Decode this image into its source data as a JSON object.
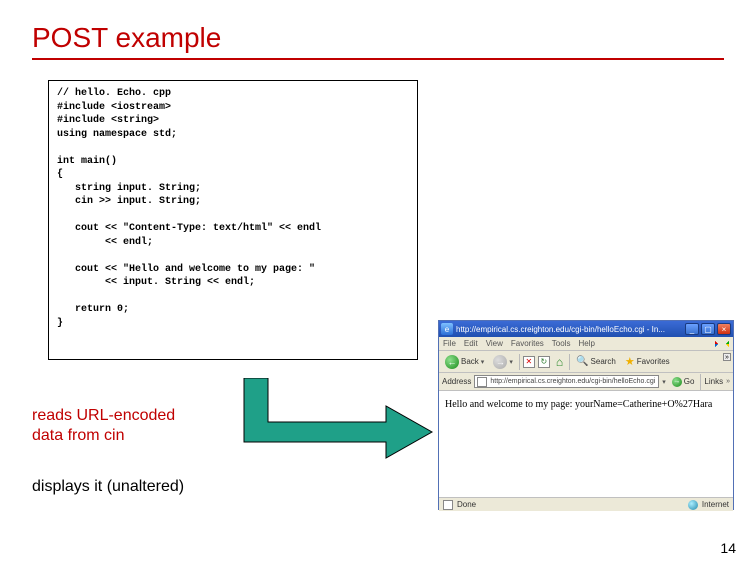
{
  "title": "POST example",
  "code": "// hello. Echo. cpp\n#include <iostream>\n#include <string>\nusing namespace std;\n\nint main()\n{\n   string input. String;\n   cin >> input. String;\n\n   cout << \"Content-Type: text/html\" << endl\n        << endl;\n\n   cout << \"Hello and welcome to my page: \"\n        << input. String << endl;\n\n   return 0;\n}",
  "caption1_line1": "reads URL-encoded",
  "caption1_line2": "data from cin",
  "caption2": "displays it (unaltered)",
  "browser": {
    "titlebar": "http://empirical.cs.creighton.edu/cgi-bin/helloEcho.cgi - In...",
    "menu": {
      "file": "File",
      "edit": "Edit",
      "view": "View",
      "favorites": "Favorites",
      "tools": "Tools",
      "help": "Help"
    },
    "toolbar": {
      "back": "Back",
      "search": "Search",
      "favorites": "Favorites"
    },
    "addr_label": "Address",
    "addr_value": "http://empirical.cs.creighton.edu/cgi-bin/helloEcho.cgi",
    "go_label": "Go",
    "links_label": "Links",
    "content": "Hello and welcome to my page: yourName=Catherine+O%27Hara",
    "status_done": "Done",
    "status_zone": "Internet"
  },
  "page_number": "14"
}
